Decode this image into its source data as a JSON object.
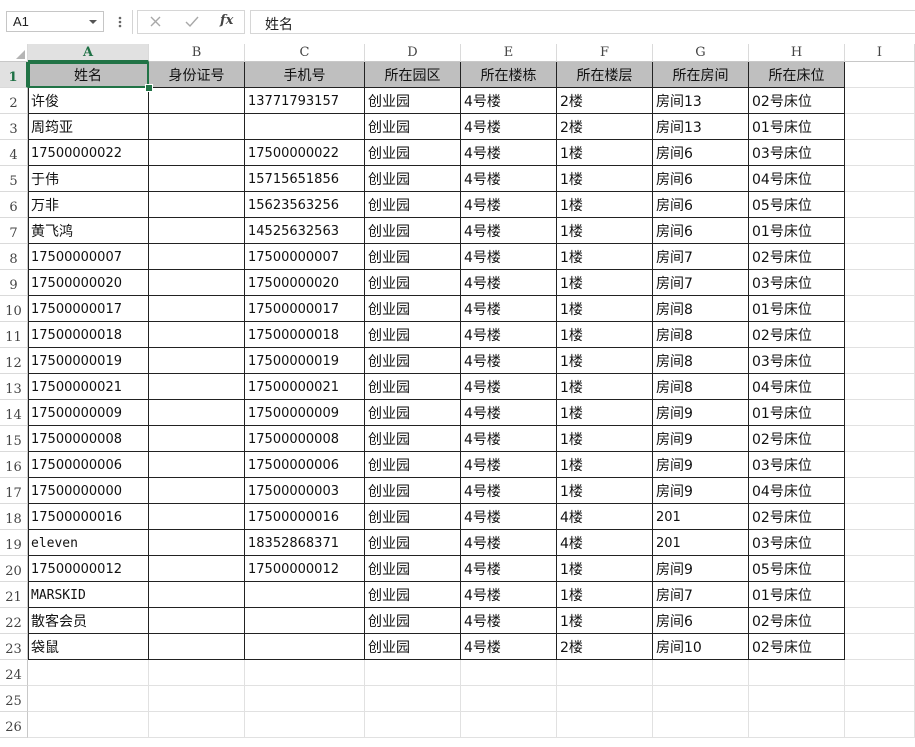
{
  "formula_bar": {
    "name_box": "A1",
    "cancel_icon": "✕",
    "enter_icon": "✓",
    "function_icon": "fx",
    "formula": "姓名"
  },
  "columns": [
    "A",
    "B",
    "C",
    "D",
    "E",
    "F",
    "G",
    "H",
    "I"
  ],
  "rows": [
    "1",
    "2",
    "3",
    "4",
    "5",
    "6",
    "7",
    "8",
    "9",
    "10",
    "11",
    "12",
    "13",
    "14",
    "15",
    "16",
    "17",
    "18",
    "19",
    "20",
    "21",
    "22",
    "23",
    "24",
    "25",
    "26"
  ],
  "table": {
    "headers": [
      "姓名",
      "身份证号",
      "手机号",
      "所在园区",
      "所在楼栋",
      "所在楼层",
      "所在房间",
      "所在床位"
    ],
    "rows": [
      [
        "许俊",
        "",
        "13771793157",
        "创业园",
        "4号楼",
        "2楼",
        "房间13",
        "02号床位"
      ],
      [
        "周筠亚",
        "",
        "",
        "创业园",
        "4号楼",
        "2楼",
        "房间13",
        "01号床位"
      ],
      [
        "17500000022",
        "",
        "17500000022",
        "创业园",
        "4号楼",
        "1楼",
        "房间6",
        "03号床位"
      ],
      [
        "于伟",
        "",
        "15715651856",
        "创业园",
        "4号楼",
        "1楼",
        "房间6",
        "04号床位"
      ],
      [
        "万非",
        "",
        "15623563256",
        "创业园",
        "4号楼",
        "1楼",
        "房间6",
        "05号床位"
      ],
      [
        "黄飞鸿",
        "",
        "14525632563",
        "创业园",
        "4号楼",
        "1楼",
        "房间6",
        "01号床位"
      ],
      [
        "17500000007",
        "",
        "17500000007",
        "创业园",
        "4号楼",
        "1楼",
        "房间7",
        "02号床位"
      ],
      [
        "17500000020",
        "",
        "17500000020",
        "创业园",
        "4号楼",
        "1楼",
        "房间7",
        "03号床位"
      ],
      [
        "17500000017",
        "",
        "17500000017",
        "创业园",
        "4号楼",
        "1楼",
        "房间8",
        "01号床位"
      ],
      [
        "17500000018",
        "",
        "17500000018",
        "创业园",
        "4号楼",
        "1楼",
        "房间8",
        "02号床位"
      ],
      [
        "17500000019",
        "",
        "17500000019",
        "创业园",
        "4号楼",
        "1楼",
        "房间8",
        "03号床位"
      ],
      [
        "17500000021",
        "",
        "17500000021",
        "创业园",
        "4号楼",
        "1楼",
        "房间8",
        "04号床位"
      ],
      [
        "17500000009",
        "",
        "17500000009",
        "创业园",
        "4号楼",
        "1楼",
        "房间9",
        "01号床位"
      ],
      [
        "17500000008",
        "",
        "17500000008",
        "创业园",
        "4号楼",
        "1楼",
        "房间9",
        "02号床位"
      ],
      [
        "17500000006",
        "",
        "17500000006",
        "创业园",
        "4号楼",
        "1楼",
        "房间9",
        "03号床位"
      ],
      [
        "17500000000",
        "",
        "17500000003",
        "创业园",
        "4号楼",
        "1楼",
        "房间9",
        "04号床位"
      ],
      [
        "17500000016",
        "",
        "17500000016",
        "创业园",
        "4号楼",
        "4楼",
        "201",
        "02号床位"
      ],
      [
        "eleven",
        "",
        "18352868371",
        "创业园",
        "4号楼",
        "4楼",
        "201",
        "03号床位"
      ],
      [
        "17500000012",
        "",
        "17500000012",
        "创业园",
        "4号楼",
        "1楼",
        "房间9",
        "05号床位"
      ],
      [
        "MARSKID",
        "",
        "",
        "创业园",
        "4号楼",
        "1楼",
        "房间7",
        "01号床位"
      ],
      [
        "散客会员",
        "",
        "",
        "创业园",
        "4号楼",
        "1楼",
        "房间6",
        "02号床位"
      ],
      [
        "袋鼠",
        "",
        "",
        "创业园",
        "4号楼",
        "2楼",
        "房间10",
        "02号床位"
      ]
    ]
  },
  "selected_cell": "A1"
}
